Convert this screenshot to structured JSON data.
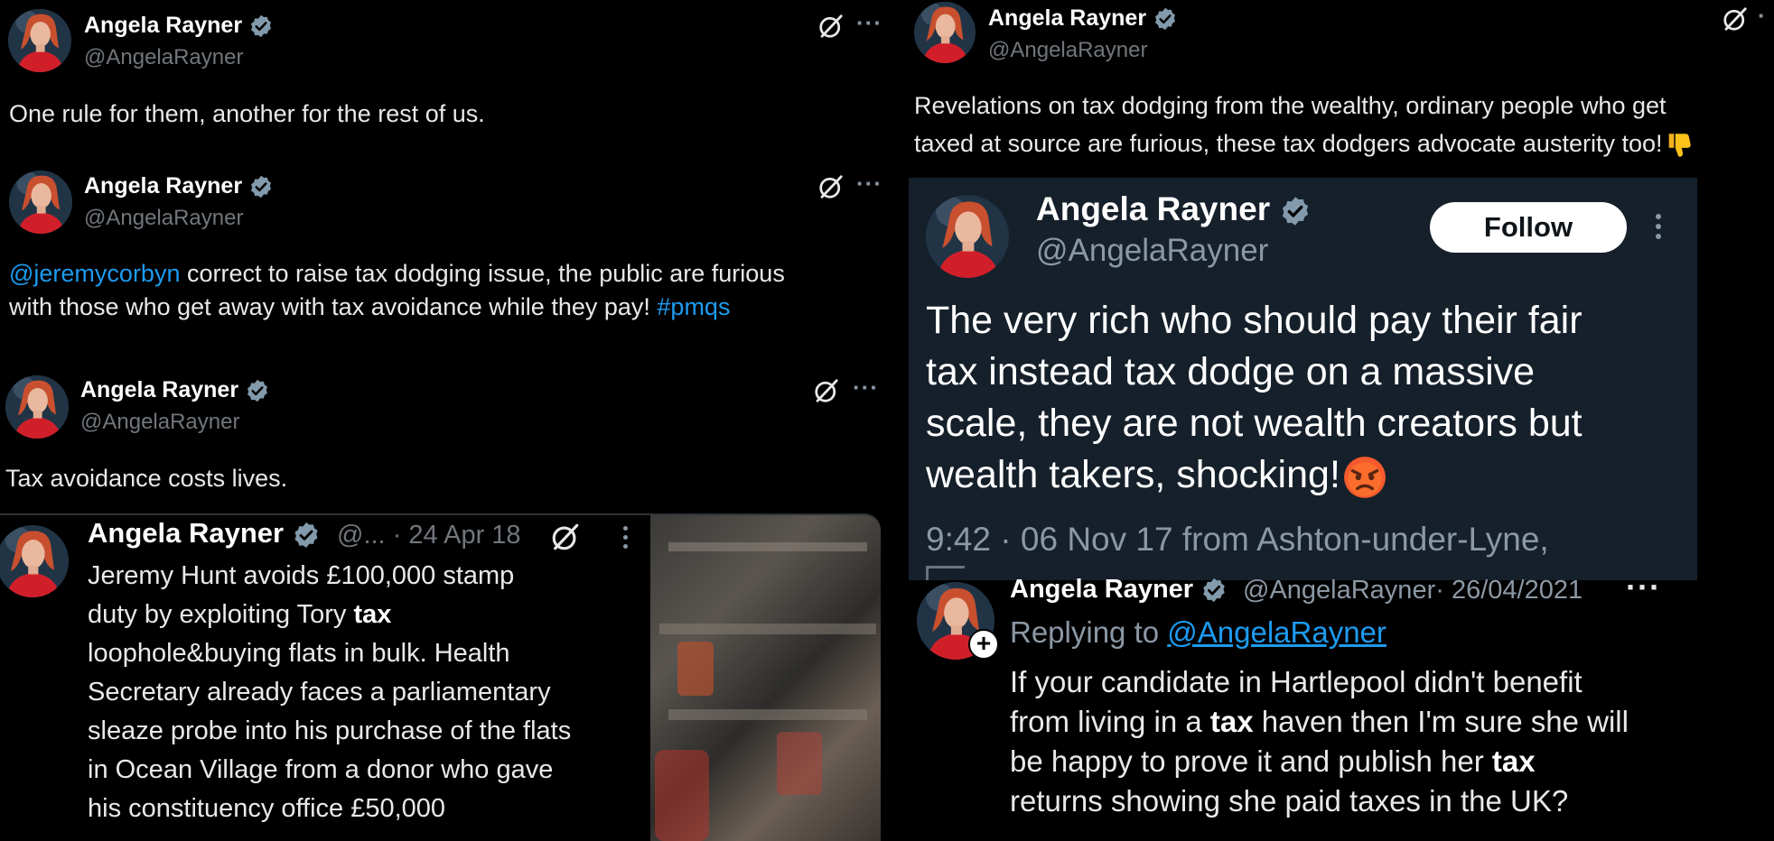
{
  "author": {
    "name": "Angela Rayner",
    "handle": "@AngelaRayner"
  },
  "tweet1": {
    "text": "One rule for them, another for the rest of us."
  },
  "tweet2": {
    "mention": "@jeremycorbyn",
    "text_a": " correct to raise tax dodging issue, the public are furious",
    "text_b": "with those who get away with tax avoidance while they pay! ",
    "hashtag": "#pmqs"
  },
  "tweet3": {
    "text": "Tax avoidance costs lives."
  },
  "tweet4": {
    "handle_trunc": "@...",
    "date": "· 24 Apr 18",
    "lines": [
      "Jeremy Hunt avoids £100,000 stamp",
      "duty by exploiting Tory ",
      "tax",
      "loophole&buying flats in bulk. Health",
      "Secretary already faces a parliamentary",
      "sleaze probe into his purchase of the flats",
      "in Ocean Village from a donor who gave",
      "his constituency office £50,000"
    ]
  },
  "tweet5": {
    "line1": "Revelations on tax dodging from the wealthy, ordinary people who get",
    "line2": "taxed at source are furious, these tax dodgers advocate austerity too!",
    "emoji": "thumbs-down"
  },
  "embed": {
    "follow_label": "Follow",
    "lines": [
      "The very rich who should pay their fair",
      "tax instead tax dodge on a massive",
      "scale, they are not wealth creators but",
      "wealth takers, shocking!"
    ],
    "emoji": "angry-face",
    "meta": "9:42 · 06 Nov 17 from Ashton-under-Lyne,"
  },
  "tweet6": {
    "date": "· 26/04/2021",
    "replying_prefix": "Replying to ",
    "replying_to": "@AngelaRayner",
    "l1": "If your candidate in Hartlepool didn't benefit",
    "l2a": "from living in a ",
    "l2b": "tax",
    "l2c": " haven then I'm sure she will",
    "l3a": "be happy to prove it and publish her ",
    "l3b": "tax",
    "l4": "returns showing she paid taxes in the UK?"
  },
  "icons": {
    "verified": "verified-badge-icon",
    "grok": "grok-icon",
    "more": "more-icon"
  },
  "colors": {
    "background": "#000000",
    "link": "#1d9bf0",
    "verified": "#829aab",
    "muted": "#71767b",
    "embed_bg": "#15202b"
  }
}
